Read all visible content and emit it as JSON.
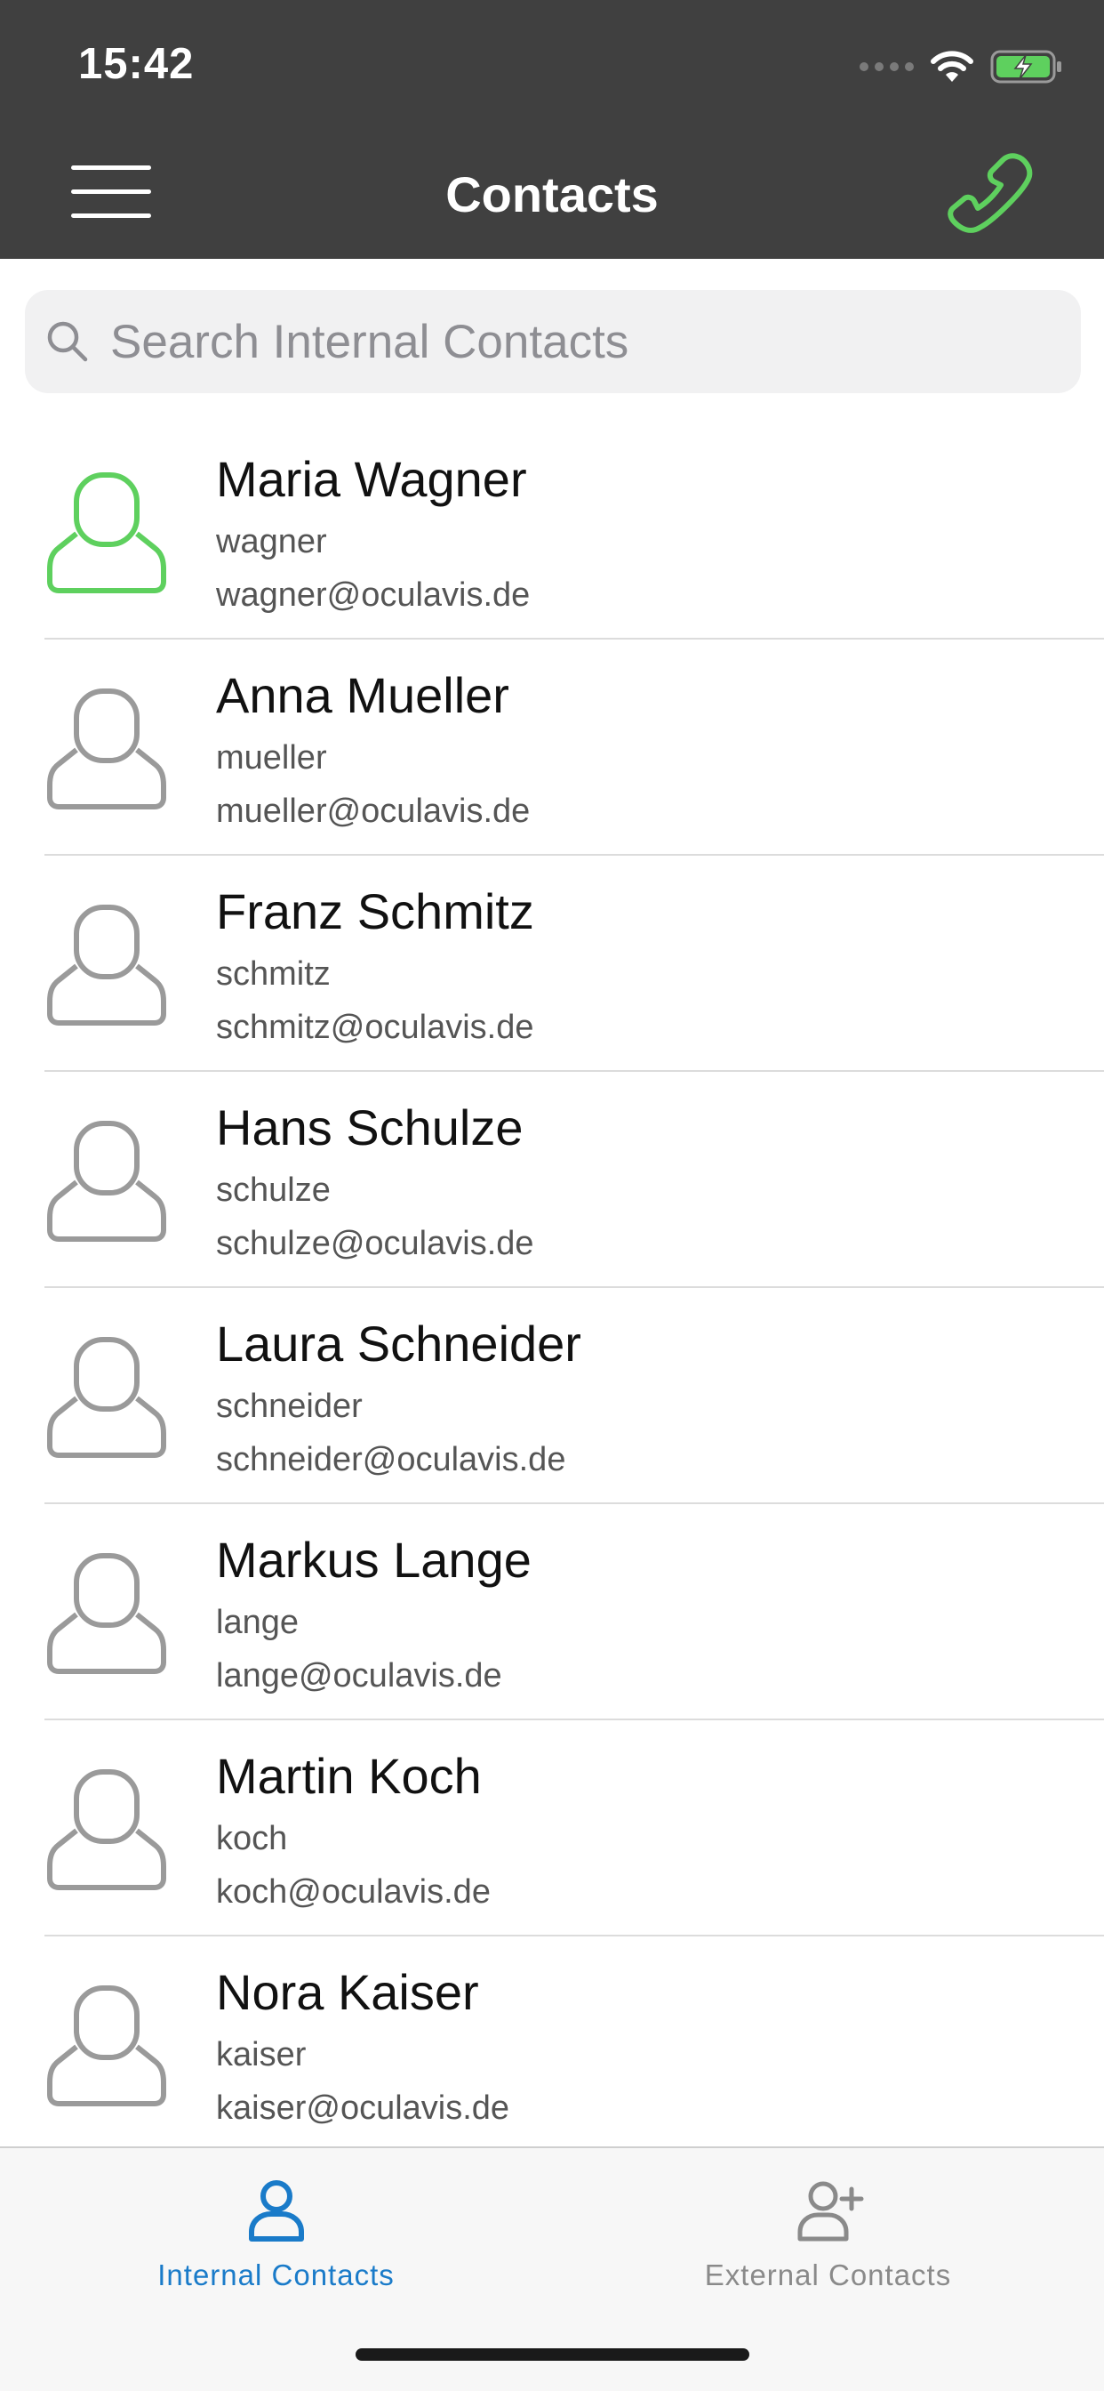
{
  "status_bar": {
    "time": "15:42"
  },
  "nav": {
    "title": "Contacts"
  },
  "colors": {
    "accent_green": "#5ed05e",
    "tab_active": "#1a7bc9",
    "tab_inactive": "#8a8a8a",
    "header_bg": "#404040"
  },
  "search": {
    "placeholder": "Search Internal Contacts",
    "value": ""
  },
  "contacts": [
    {
      "name": "Maria Wagner",
      "username": "wagner",
      "email": "wagner@oculavis.de",
      "online": true
    },
    {
      "name": "Anna Mueller",
      "username": "mueller",
      "email": "mueller@oculavis.de",
      "online": false
    },
    {
      "name": "Franz Schmitz",
      "username": "schmitz",
      "email": "schmitz@oculavis.de",
      "online": false
    },
    {
      "name": "Hans Schulze",
      "username": "schulze",
      "email": "schulze@oculavis.de",
      "online": false
    },
    {
      "name": "Laura Schneider",
      "username": "schneider",
      "email": "schneider@oculavis.de",
      "online": false
    },
    {
      "name": "Markus Lange",
      "username": "lange",
      "email": "lange@oculavis.de",
      "online": false
    },
    {
      "name": "Martin Koch",
      "username": "koch",
      "email": "koch@oculavis.de",
      "online": false
    },
    {
      "name": "Nora Kaiser",
      "username": "kaiser",
      "email": "kaiser@oculavis.de",
      "online": false
    }
  ],
  "tabs": [
    {
      "label": "Internal Contacts",
      "icon": "user-icon",
      "active": true
    },
    {
      "label": "External Contacts",
      "icon": "user-add-icon",
      "active": false
    }
  ]
}
